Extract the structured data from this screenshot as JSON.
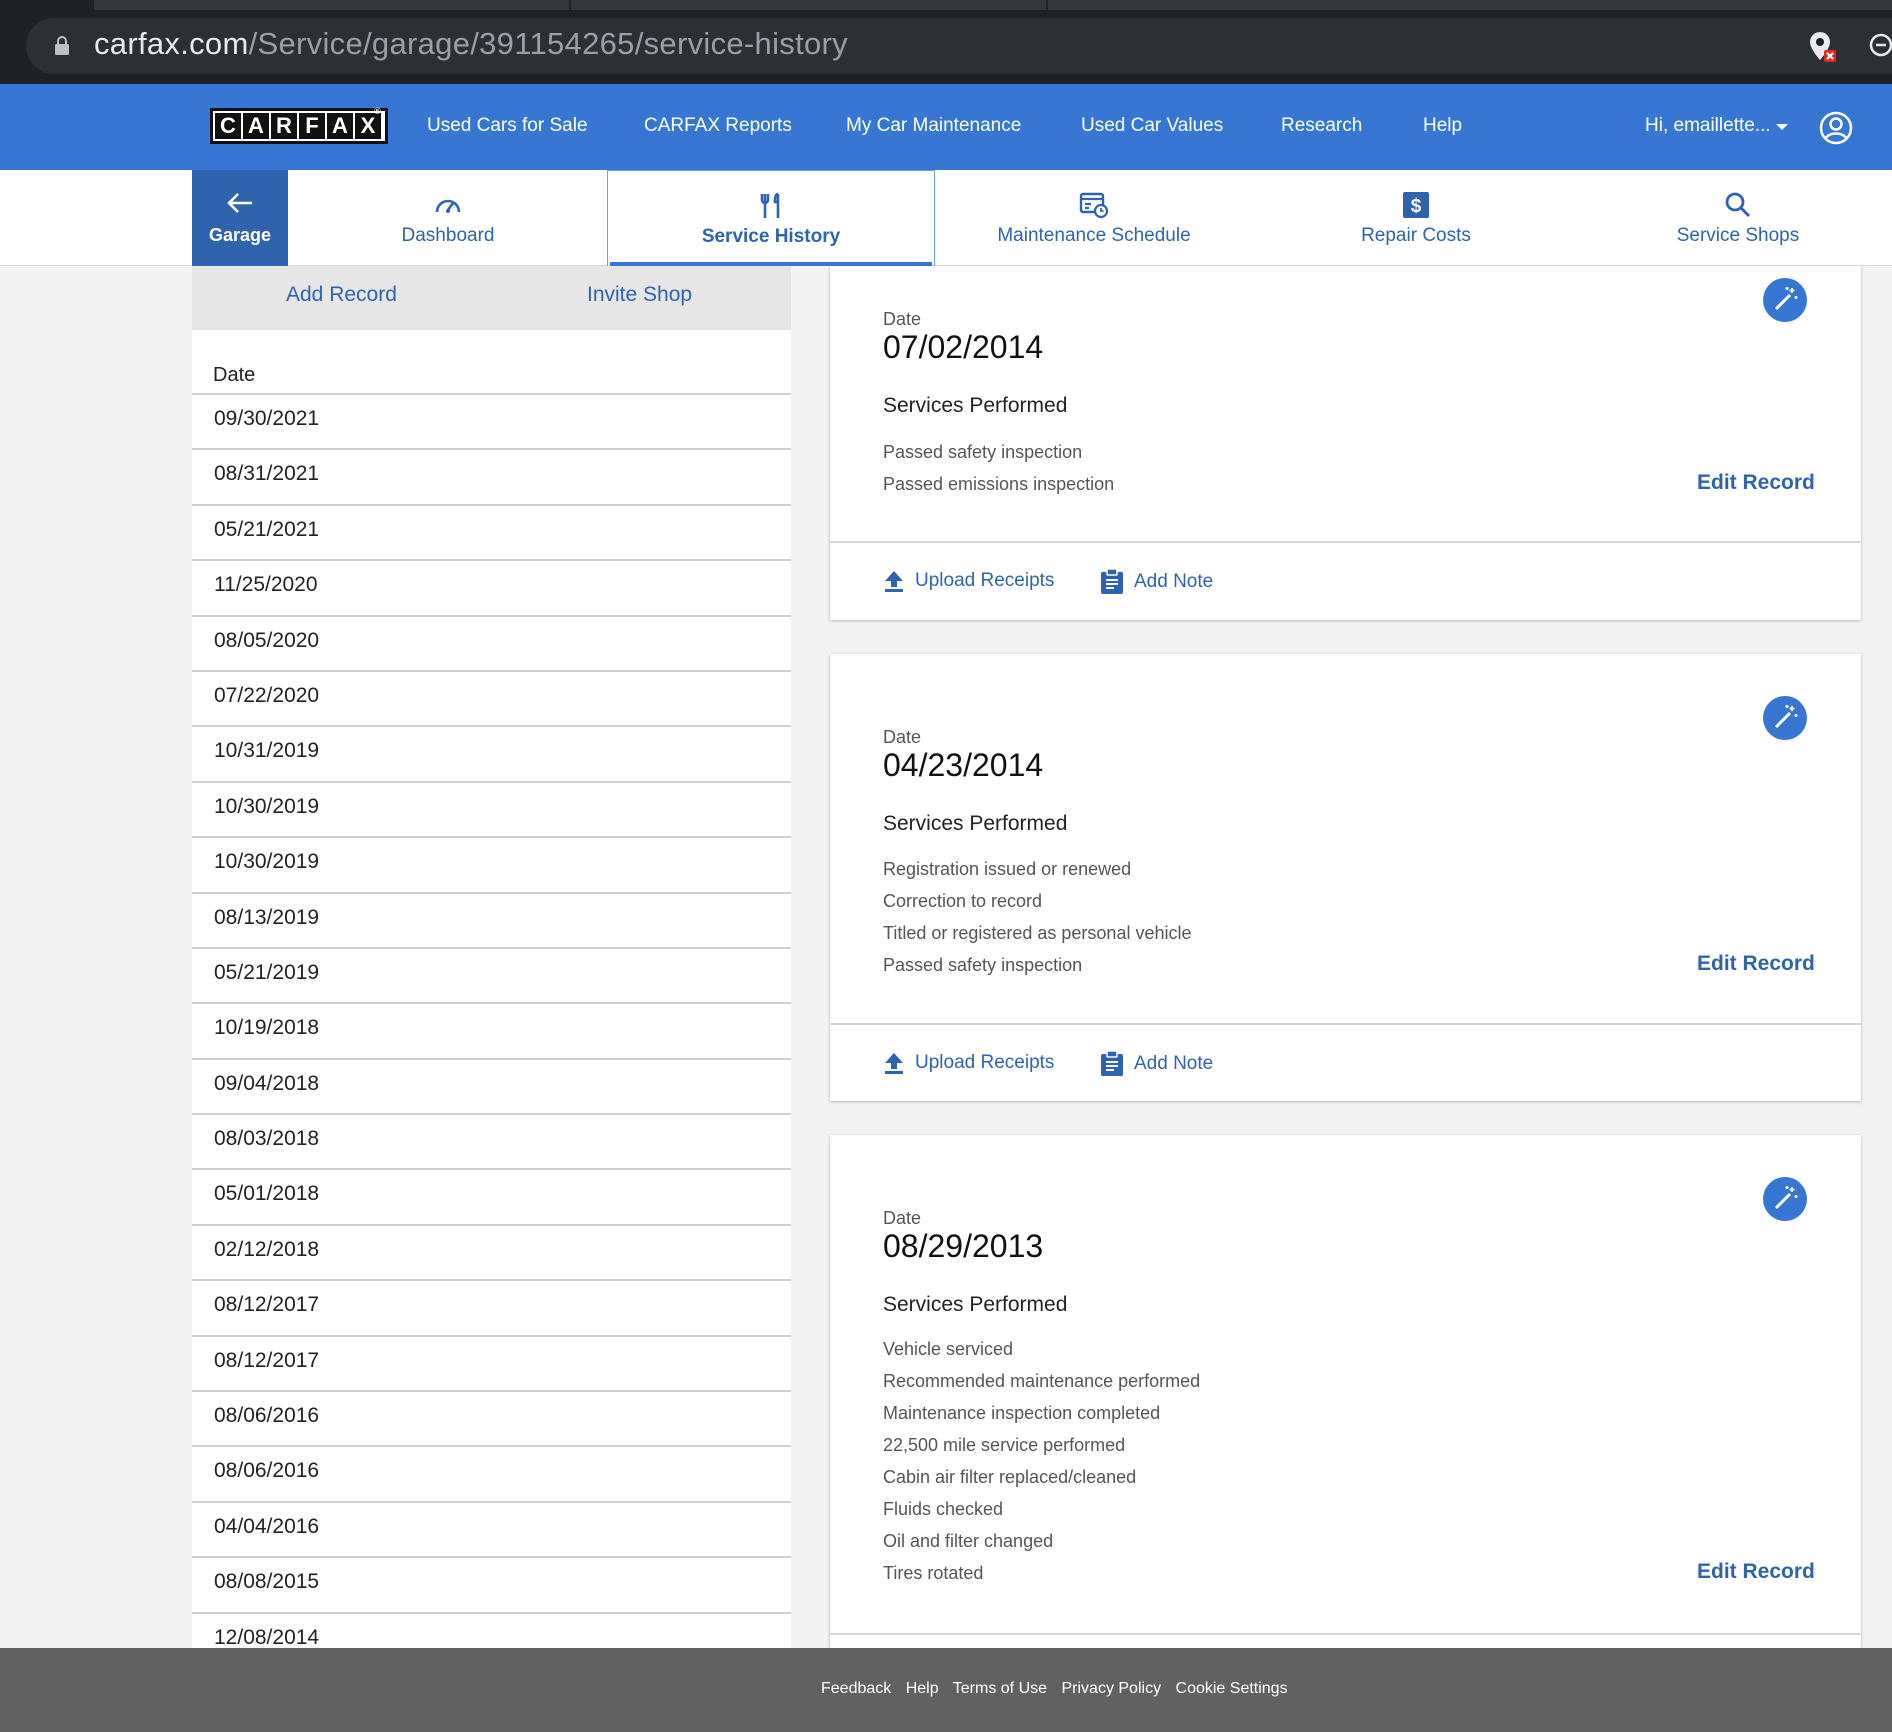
{
  "browser": {
    "url_host": "carfax.com",
    "url_path": "/Service/garage/391154265/service-history"
  },
  "topnav": {
    "logo_letters": [
      "C",
      "A",
      "R",
      "F",
      "A",
      "X"
    ],
    "links": [
      "Used Cars for Sale",
      "CARFAX Reports",
      "My Car Maintenance",
      "Used Car Values",
      "Research",
      "Help"
    ],
    "user_greeting": "Hi, emaillette..."
  },
  "subnav": {
    "garage": "Garage",
    "tabs": [
      "Dashboard",
      "Service History",
      "Maintenance Schedule",
      "Repair Costs",
      "Service Shops"
    ],
    "active_tab": "Service History"
  },
  "left_panel": {
    "add_record": "Add Record",
    "invite_shop": "Invite Shop",
    "date_header": "Date",
    "dates": [
      "09/30/2021",
      "08/31/2021",
      "05/21/2021",
      "11/25/2020",
      "08/05/2020",
      "07/22/2020",
      "10/31/2019",
      "10/30/2019",
      "10/30/2019",
      "08/13/2019",
      "05/21/2019",
      "10/19/2018",
      "09/04/2018",
      "08/03/2018",
      "05/01/2018",
      "02/12/2018",
      "08/12/2017",
      "08/12/2017",
      "08/06/2016",
      "08/06/2016",
      "04/04/2016",
      "08/08/2015",
      "12/08/2014"
    ]
  },
  "records": [
    {
      "date_label": "Date",
      "date": "07/02/2014",
      "services_title": "Services Performed",
      "services": [
        "Passed safety inspection",
        "Passed emissions inspection"
      ],
      "edit": "Edit Record",
      "upload": "Upload Receipts",
      "note": "Add Note"
    },
    {
      "date_label": "Date",
      "date": "04/23/2014",
      "services_title": "Services Performed",
      "services": [
        "Registration issued or renewed",
        "Correction to record",
        "Titled or registered as personal vehicle",
        "Passed safety inspection"
      ],
      "edit": "Edit Record",
      "upload": "Upload Receipts",
      "note": "Add Note"
    },
    {
      "date_label": "Date",
      "date": "08/29/2013",
      "services_title": "Services Performed",
      "services": [
        "Vehicle serviced",
        "Recommended maintenance performed",
        "Maintenance inspection completed",
        "22,500 mile service performed",
        "Cabin air filter replaced/cleaned",
        "Fluids checked",
        "Oil and filter changed",
        "Tires rotated"
      ],
      "edit": "Edit Record"
    }
  ],
  "footer": [
    "Feedback",
    "Help",
    "Terms of Use",
    "Privacy Policy",
    "Cookie Settings"
  ],
  "colors": {
    "brand_blue": "#3777d3",
    "link_blue": "#2f63ae",
    "footer_gray": "#616161"
  }
}
